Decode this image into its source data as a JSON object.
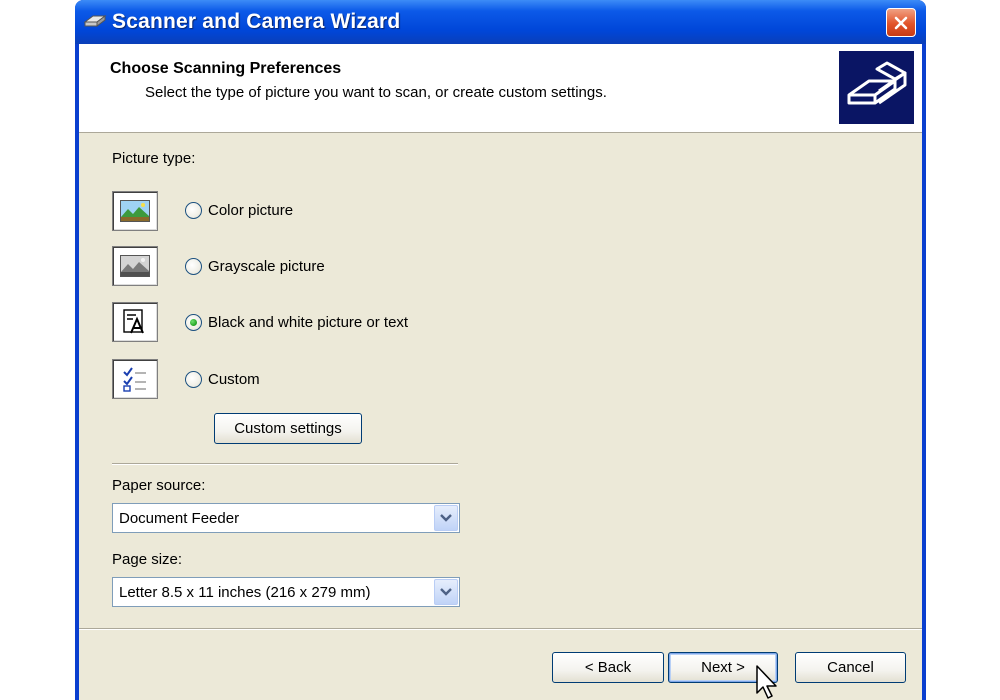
{
  "window": {
    "title": "Scanner and Camera Wizard",
    "close_label": "Close"
  },
  "header": {
    "title": "Choose Scanning Preferences",
    "subtitle": "Select the type of picture you want to scan, or create custom settings."
  },
  "picture_type": {
    "label": "Picture type:",
    "options": [
      {
        "label": "Color picture",
        "checked": false
      },
      {
        "label": "Grayscale picture",
        "checked": false
      },
      {
        "label": "Black and white picture or text",
        "checked": true
      },
      {
        "label": "Custom",
        "checked": false
      }
    ],
    "custom_settings_button": "Custom settings"
  },
  "paper_source": {
    "label": "Paper source:",
    "value": "Document Feeder"
  },
  "page_size": {
    "label": "Page size:",
    "value": "Letter 8.5 x 11 inches (216 x 279 mm)"
  },
  "footer": {
    "back": "< Back",
    "next": "Next >",
    "cancel": "Cancel"
  },
  "colors": {
    "titlebar": "#0046d8",
    "dialog_bg": "#ece9d8",
    "radio_checked": "#21a121"
  }
}
